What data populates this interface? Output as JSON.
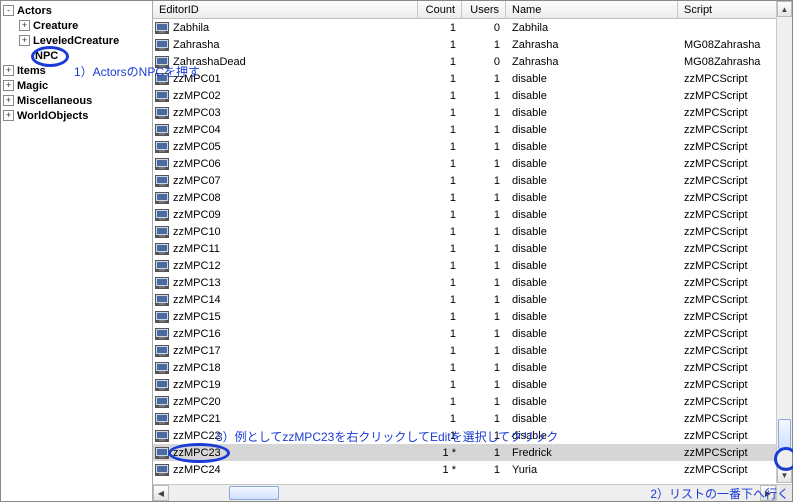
{
  "tree": {
    "root": "Actors",
    "children": [
      {
        "label": "Creature",
        "expandable": true
      },
      {
        "label": "LeveledCreature",
        "expandable": true
      },
      {
        "label": "NPC",
        "expandable": false,
        "highlighted": true
      }
    ],
    "siblings": [
      "Items",
      "Magic",
      "Miscellaneous",
      "WorldObjects"
    ]
  },
  "columns": {
    "editor": "EditorID",
    "count": "Count",
    "users": "Users",
    "name": "Name",
    "script": "Script"
  },
  "rows": [
    {
      "id": "Zabhila",
      "count": "1",
      "users": "0",
      "name": "Zabhila",
      "script": ""
    },
    {
      "id": "Zahrasha",
      "count": "1",
      "users": "1",
      "name": "Zahrasha",
      "script": "MG08Zahrasha"
    },
    {
      "id": "ZahrashaDead",
      "count": "1",
      "users": "0",
      "name": "Zahrasha",
      "script": "MG08Zahrasha"
    },
    {
      "id": "zzMPC01",
      "count": "1",
      "users": "1",
      "name": "disable",
      "script": "zzMPCScript"
    },
    {
      "id": "zzMPC02",
      "count": "1",
      "users": "1",
      "name": "disable",
      "script": "zzMPCScript"
    },
    {
      "id": "zzMPC03",
      "count": "1",
      "users": "1",
      "name": "disable",
      "script": "zzMPCScript"
    },
    {
      "id": "zzMPC04",
      "count": "1",
      "users": "1",
      "name": "disable",
      "script": "zzMPCScript"
    },
    {
      "id": "zzMPC05",
      "count": "1",
      "users": "1",
      "name": "disable",
      "script": "zzMPCScript"
    },
    {
      "id": "zzMPC06",
      "count": "1",
      "users": "1",
      "name": "disable",
      "script": "zzMPCScript"
    },
    {
      "id": "zzMPC07",
      "count": "1",
      "users": "1",
      "name": "disable",
      "script": "zzMPCScript"
    },
    {
      "id": "zzMPC08",
      "count": "1",
      "users": "1",
      "name": "disable",
      "script": "zzMPCScript"
    },
    {
      "id": "zzMPC09",
      "count": "1",
      "users": "1",
      "name": "disable",
      "script": "zzMPCScript"
    },
    {
      "id": "zzMPC10",
      "count": "1",
      "users": "1",
      "name": "disable",
      "script": "zzMPCScript"
    },
    {
      "id": "zzMPC11",
      "count": "1",
      "users": "1",
      "name": "disable",
      "script": "zzMPCScript"
    },
    {
      "id": "zzMPC12",
      "count": "1",
      "users": "1",
      "name": "disable",
      "script": "zzMPCScript"
    },
    {
      "id": "zzMPC13",
      "count": "1",
      "users": "1",
      "name": "disable",
      "script": "zzMPCScript"
    },
    {
      "id": "zzMPC14",
      "count": "1",
      "users": "1",
      "name": "disable",
      "script": "zzMPCScript"
    },
    {
      "id": "zzMPC15",
      "count": "1",
      "users": "1",
      "name": "disable",
      "script": "zzMPCScript"
    },
    {
      "id": "zzMPC16",
      "count": "1",
      "users": "1",
      "name": "disable",
      "script": "zzMPCScript"
    },
    {
      "id": "zzMPC17",
      "count": "1",
      "users": "1",
      "name": "disable",
      "script": "zzMPCScript"
    },
    {
      "id": "zzMPC18",
      "count": "1",
      "users": "1",
      "name": "disable",
      "script": "zzMPCScript"
    },
    {
      "id": "zzMPC19",
      "count": "1",
      "users": "1",
      "name": "disable",
      "script": "zzMPCScript"
    },
    {
      "id": "zzMPC20",
      "count": "1",
      "users": "1",
      "name": "disable",
      "script": "zzMPCScript"
    },
    {
      "id": "zzMPC21",
      "count": "1",
      "users": "1",
      "name": "disable",
      "script": "zzMPCScript"
    },
    {
      "id": "zzMPC22",
      "count": "1",
      "users": "1",
      "name": "disable",
      "script": "zzMPCScript"
    },
    {
      "id": "zzMPC23",
      "count": "1 *",
      "users": "1",
      "name": "Fredrick",
      "script": "zzMPCScript",
      "selected": true,
      "circled": true
    },
    {
      "id": "zzMPC24",
      "count": "1 *",
      "users": "1",
      "name": "Yuria",
      "script": "zzMPCScript"
    }
  ],
  "annotations": {
    "a1": "1）ActorsのNPCを押す",
    "a2": "2）リストの一番下へ行く",
    "a3": "3）例としてzzMPC23を右クリックしてEditを選択してクリック"
  }
}
